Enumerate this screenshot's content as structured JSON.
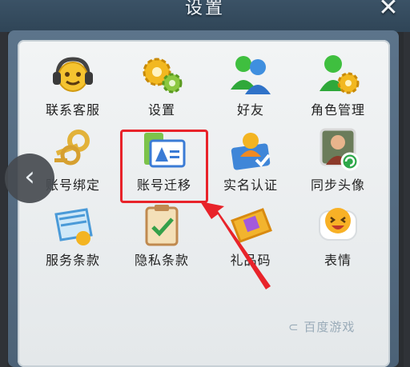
{
  "header": {
    "title": "设置",
    "close_icon": "close-icon"
  },
  "grid": {
    "items": [
      {
        "label": "联系客服",
        "icon": "headset-emoji-icon"
      },
      {
        "label": "设置",
        "icon": "gears-icon"
      },
      {
        "label": "好友",
        "icon": "friends-icon"
      },
      {
        "label": "角色管理",
        "icon": "role-gear-icon"
      },
      {
        "label": "账号绑定",
        "icon": "keys-icon"
      },
      {
        "label": "账号迁移",
        "icon": "account-migration-icon"
      },
      {
        "label": "实名认证",
        "icon": "id-card-icon"
      },
      {
        "label": "同步头像",
        "icon": "avatar-sync-icon"
      },
      {
        "label": "服务条款",
        "icon": "terms-icon"
      },
      {
        "label": "隐私条款",
        "icon": "privacy-clipboard-icon"
      },
      {
        "label": "礼品码",
        "icon": "gift-ticket-icon"
      },
      {
        "label": "表情",
        "icon": "emoji-icon"
      }
    ]
  },
  "nav": {
    "back_icon": "chevron-left-icon"
  },
  "watermark": {
    "text": "百度游戏"
  },
  "colors": {
    "highlight": "#e8232a",
    "panel": "#eef1f3",
    "frame": "#566e84"
  }
}
